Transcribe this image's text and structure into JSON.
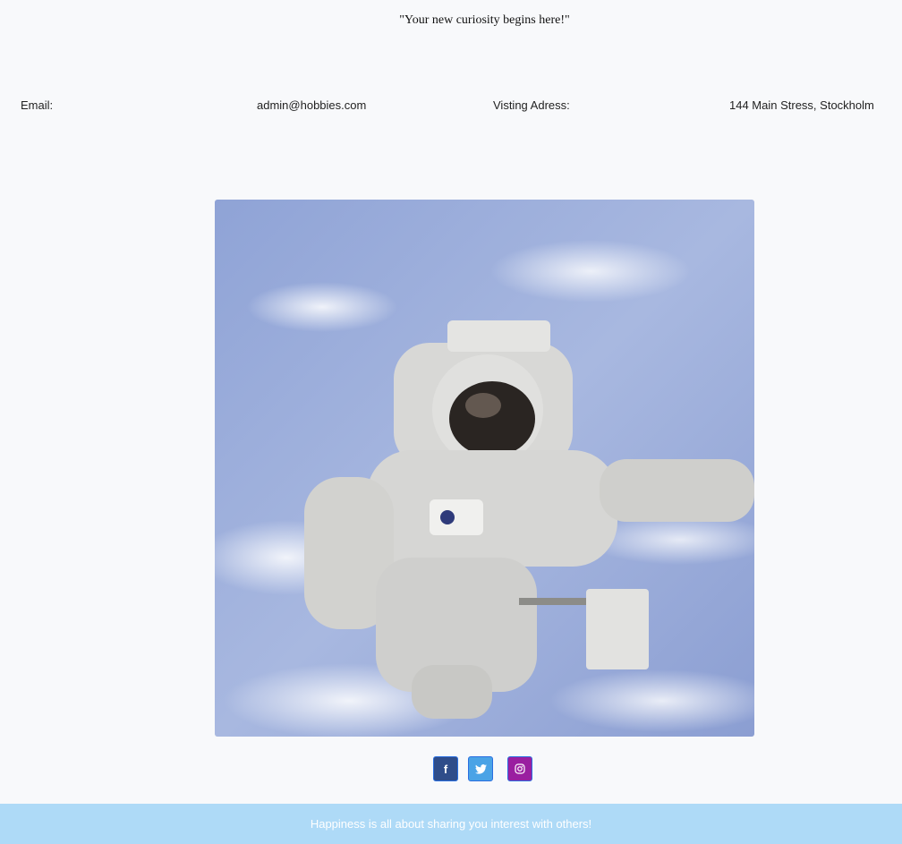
{
  "header": {
    "quote": "\"Your new curiosity begins here!\""
  },
  "contact": {
    "email_label": "Email:",
    "email_value": "admin@hobbies.com",
    "address_label": "Visting Adress:",
    "address_value": "144 Main Stress, Stockholm"
  },
  "image": {
    "alt": "Astronaut floating in space above the Earth"
  },
  "social": [
    {
      "name": "facebook",
      "glyph": "f",
      "color": "#2f4d8a"
    },
    {
      "name": "twitter",
      "glyph": "🐦",
      "color": "#4aa3e6"
    },
    {
      "name": "instagram",
      "glyph": "◎",
      "color": "#9a1fa0"
    }
  ],
  "footer": {
    "text": "Happiness is all about sharing you interest with others!"
  }
}
